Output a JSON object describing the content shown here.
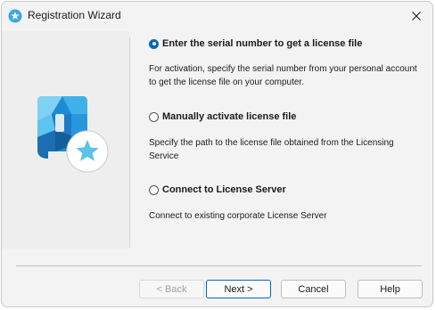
{
  "window": {
    "title": "Registration Wizard",
    "app_icon": "star-badge-icon",
    "close_icon": "close-icon"
  },
  "sidebar": {
    "logo": "license-document-star-icon"
  },
  "options": [
    {
      "label": "Enter the serial number to get a license file",
      "description": "For activation, specify the serial number from your personal account to get the license file on your computer.",
      "selected": true
    },
    {
      "label": "Manually activate license file",
      "description": "Specify the path to the license file obtained from the Licensing Service",
      "selected": false
    },
    {
      "label": "Connect to License Server",
      "description": "Connect to existing corporate License Server",
      "selected": false
    }
  ],
  "buttons": {
    "back": "< Back",
    "next": "Next >",
    "cancel": "Cancel",
    "help": "Help"
  },
  "colors": {
    "accent": "#0067c0",
    "logo_blue": "#1e8bd6",
    "logo_light": "#7fd1f2",
    "star": "#5bc3ea"
  }
}
